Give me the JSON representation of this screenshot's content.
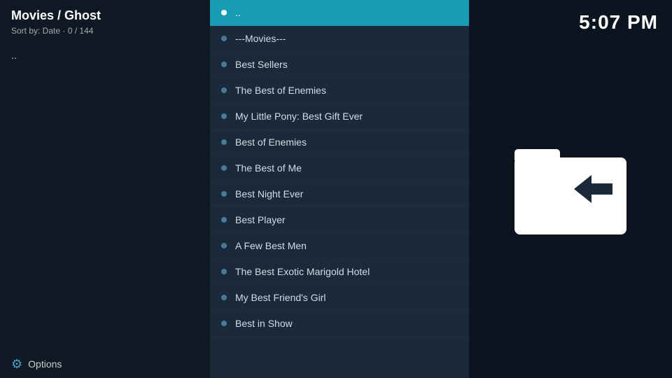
{
  "header": {
    "title": "Movies / Ghost",
    "sort": "Sort by: Date",
    "count": "0 / 144"
  },
  "clock": "5:07 PM",
  "sidebar": {
    "dotdot": "..",
    "options_label": "Options"
  },
  "list": {
    "selected_item": "..",
    "items": [
      {
        "id": "dotdot",
        "label": "..",
        "selected": true
      },
      {
        "id": "movies-header",
        "label": "---Movies---",
        "selected": false
      },
      {
        "id": "best-sellers",
        "label": "Best Sellers",
        "selected": false
      },
      {
        "id": "the-best-of-enemies",
        "label": "The Best of Enemies",
        "selected": false
      },
      {
        "id": "my-little-pony",
        "label": "My Little Pony: Best Gift Ever",
        "selected": false
      },
      {
        "id": "best-of-enemies",
        "label": "Best of Enemies",
        "selected": false
      },
      {
        "id": "the-best-of-me",
        "label": "The Best of Me",
        "selected": false
      },
      {
        "id": "best-night-ever",
        "label": "Best Night Ever",
        "selected": false
      },
      {
        "id": "best-player",
        "label": "Best Player",
        "selected": false
      },
      {
        "id": "a-few-best-men",
        "label": "A Few Best Men",
        "selected": false
      },
      {
        "id": "the-best-exotic-marigold-hotel",
        "label": "The Best Exotic Marigold Hotel",
        "selected": false
      },
      {
        "id": "my-best-friends-girl",
        "label": "My Best Friend's Girl",
        "selected": false
      },
      {
        "id": "best-in-show",
        "label": "Best in Show",
        "selected": false
      }
    ]
  }
}
